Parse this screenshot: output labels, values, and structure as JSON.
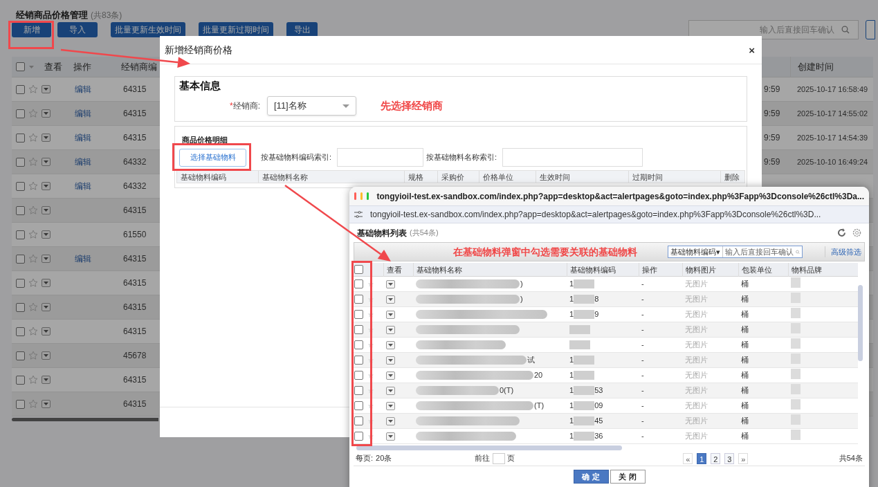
{
  "page": {
    "title": "经销商品价格管理",
    "count": "(共83条)",
    "buttons": [
      "新增",
      "导入",
      "批量更新生效时间",
      "批量更新过期时间",
      "导出"
    ],
    "search": {
      "placeholder": "输入后直接回车确认"
    },
    "table": {
      "all_checked": false,
      "columns": [
        "查看",
        "操作",
        "经销商编",
        "创建时间"
      ],
      "rows": [
        {
          "checked": false,
          "edit": "编辑",
          "code": "64315",
          "time_tail": "9:59",
          "created": "2025-10-17 16:58:49"
        },
        {
          "checked": false,
          "edit": "编辑",
          "code": "64315",
          "time_tail": "9:59",
          "created": "2025-10-17 14:55:02"
        },
        {
          "checked": false,
          "edit": "编辑",
          "code": "64315",
          "time_tail": "9:59",
          "created": "2025-10-17 14:54:39"
        },
        {
          "checked": false,
          "edit": "编辑",
          "code": "64332",
          "time_tail": "9:59",
          "created": "2025-10-10 16:49:24"
        },
        {
          "checked": false,
          "edit": "编辑",
          "code": "64332"
        },
        {
          "checked": false,
          "code": "64315"
        },
        {
          "checked": false,
          "code": "61550"
        },
        {
          "checked": false,
          "edit": "编辑",
          "code": "64315"
        },
        {
          "checked": false,
          "code": "64315"
        },
        {
          "checked": false,
          "code": "64315"
        },
        {
          "checked": false,
          "code": "64315"
        },
        {
          "checked": false,
          "code": "45678"
        },
        {
          "checked": false,
          "code": "64315"
        },
        {
          "checked": false,
          "code": "64315"
        }
      ]
    }
  },
  "dialog": {
    "title": "新增经销商价格",
    "close": "×",
    "basic": {
      "heading": "基本信息",
      "required_mark": "*",
      "dealer_label": "经销商:",
      "dealer_value": "[11]名称"
    },
    "detail": {
      "heading": "商品价格明细",
      "select_button": "选择基础物料",
      "code_search_label": "按基础物料编码索引:",
      "name_search_label": "按基础物料名称索引:",
      "columns": [
        "基础物料编码",
        "基础物料名称",
        "规格",
        "采购价",
        "价格单位",
        "生效时间",
        "过期时间",
        "删除"
      ]
    }
  },
  "popup": {
    "window_title": "tongyioil-test.ex-sandbox.com/index.php?app=desktop&act=alertpages&goto=index.php%3Fapp%3Dconsole%26ctl%3Da...",
    "address": "tongyioil-test.ex-sandbox.com/index.php?app=desktop&act=alertpages&goto=index.php%3Fapp%3Dconsole%26ctl%3D...",
    "list_title": "基础物料列表",
    "list_count": "(共54条)",
    "search_field": "基础物料编码▾",
    "search_placeholder": "输入后直接回车确认",
    "advanced_filter": "高级筛选",
    "all_checked": false,
    "columns": [
      "查看",
      "基础物料名称",
      "基础物料编码",
      "操作",
      "物料图片",
      "包装单位",
      "物料品牌"
    ],
    "rows": [
      {
        "checked": false,
        "name_tail": ")",
        "code_head": "1",
        "code_tail": "",
        "op": "-",
        "image": "无图片",
        "unit": "桶"
      },
      {
        "checked": false,
        "name_tail": ")",
        "code_head": "1",
        "code_tail": "8",
        "op": "-",
        "image": "无图片",
        "unit": "桶"
      },
      {
        "checked": false,
        "name_tail": "",
        "code_head": "1",
        "code_tail": "9",
        "op": "-",
        "image": "无图片",
        "unit": "桶"
      },
      {
        "checked": false,
        "name_tail": "",
        "code_head": "",
        "code_tail": "",
        "op": "-",
        "image": "无图片",
        "unit": "桶"
      },
      {
        "checked": false,
        "name_tail": "",
        "code_head": "",
        "code_tail": "",
        "op": "-",
        "image": "无图片",
        "unit": "桶"
      },
      {
        "checked": false,
        "name_tail": "试",
        "code_head": "1",
        "code_tail": "",
        "op": "-",
        "image": "无图片",
        "unit": "桶"
      },
      {
        "checked": false,
        "name_tail": "20",
        "code_head": "1",
        "code_tail": "",
        "op": "-",
        "image": "无图片",
        "unit": "桶"
      },
      {
        "checked": false,
        "name_tail": "0(T)",
        "code_head": "1",
        "code_tail": "53",
        "op": "-",
        "image": "无图片",
        "unit": "桶"
      },
      {
        "checked": false,
        "name_tail": "(T)",
        "code_head": "1",
        "code_tail": "09",
        "op": "-",
        "image": "无图片",
        "unit": "桶"
      },
      {
        "checked": false,
        "name_tail": "",
        "code_head": "1",
        "code_tail": "45",
        "op": "-",
        "image": "无图片",
        "unit": "桶"
      },
      {
        "checked": false,
        "name_tail": "",
        "code_head": "1",
        "code_tail": "36",
        "op": "-",
        "image": "无图片",
        "unit": "桶"
      }
    ],
    "pager": {
      "per_page_label": "每页:",
      "per_page": "20条",
      "goto_label": "前往",
      "goto_unit": "页",
      "first": "«",
      "pages": [
        {
          "label": "1",
          "selected": true
        },
        {
          "label": "2",
          "selected": false
        },
        {
          "label": "3",
          "selected": false
        }
      ],
      "last": "»",
      "total": "共54条"
    },
    "buttons": [
      "确 定",
      "关 闭"
    ]
  },
  "annotations": {
    "dealer_hint": "先选择经销商",
    "popup_hint": "在基础物料弹窗中勾选需要关联的基础物料"
  }
}
